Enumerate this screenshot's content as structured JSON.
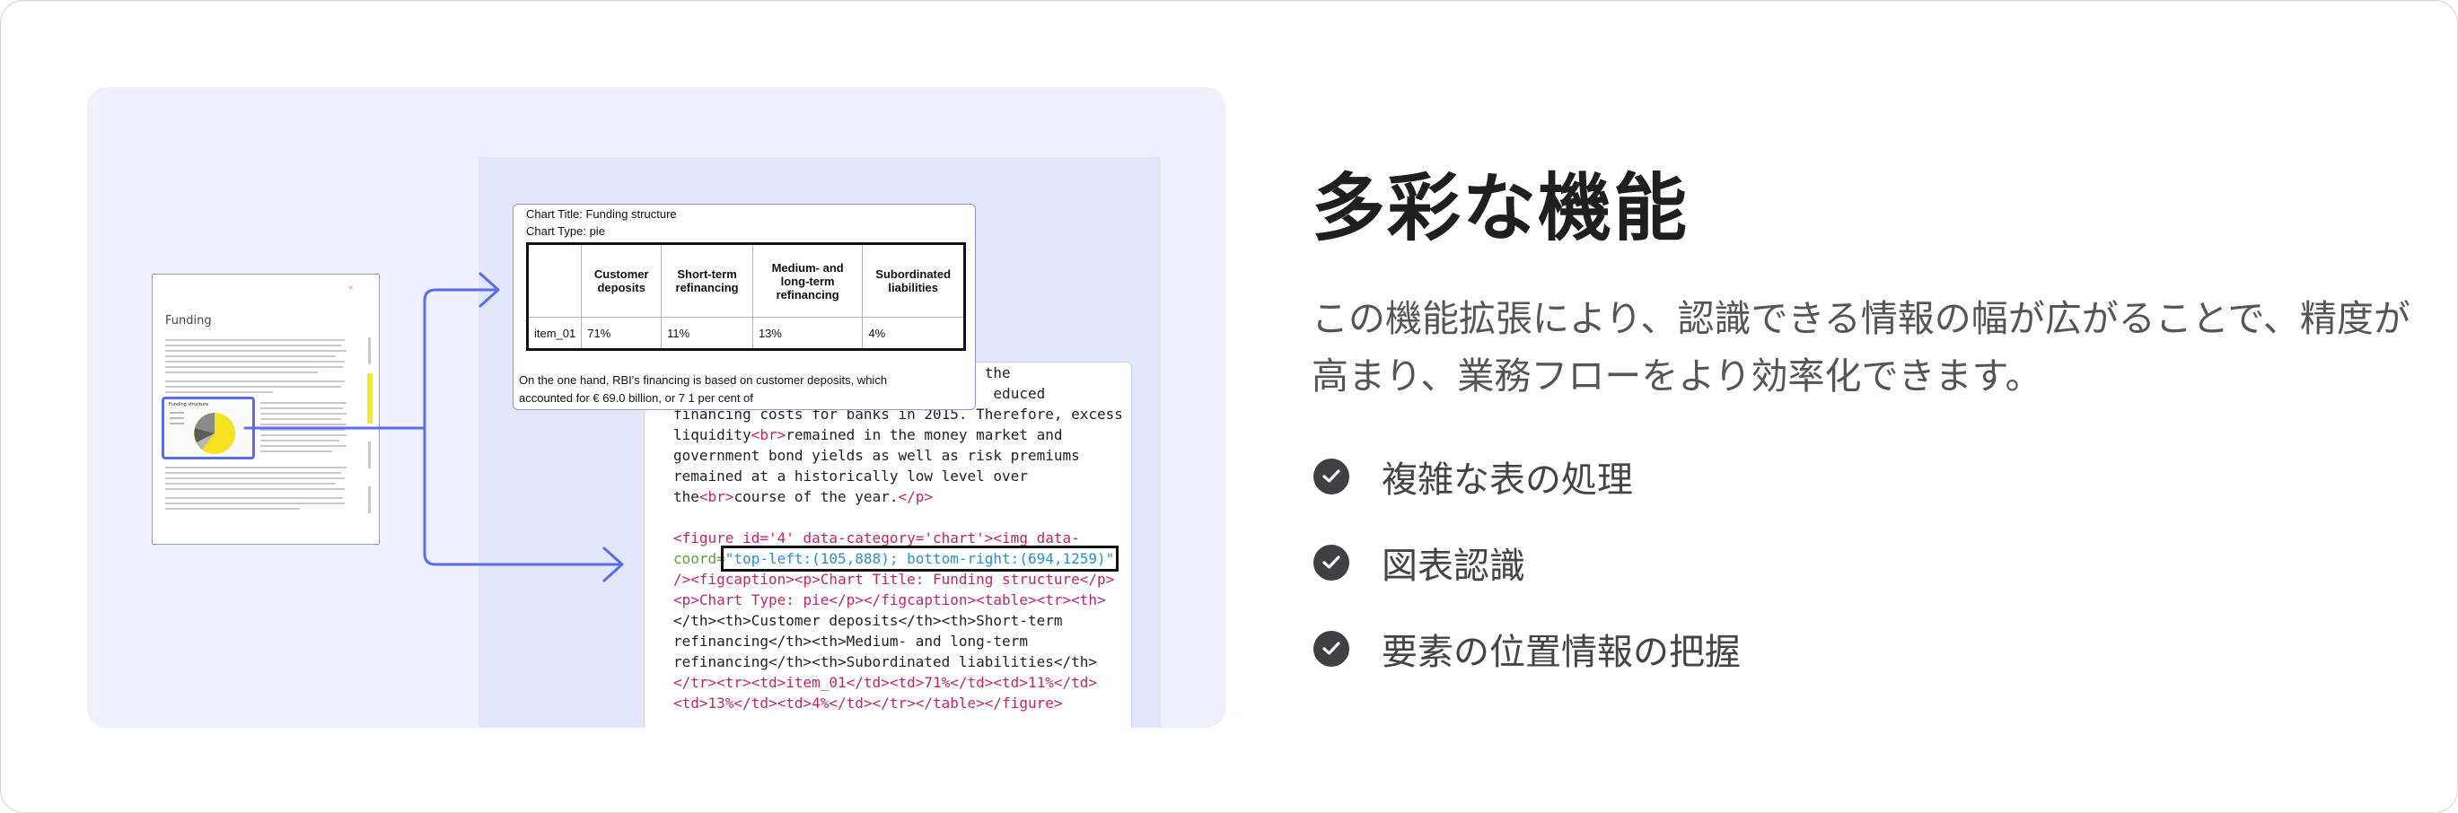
{
  "document_thumbnail": {
    "title": "Funding",
    "close_mark": "×",
    "figure_label": "Funding structure"
  },
  "table_card": {
    "chart_title_line": "Chart Title: Funding structure",
    "chart_type_line": "Chart Type: pie",
    "columns": [
      "",
      "Customer deposits",
      "Short-term refinancing",
      "Medium- and long-term refinancing",
      "Subordinated liabilities"
    ],
    "row": [
      "item_01",
      "71%",
      "11%",
      "13%",
      "4%"
    ],
    "paragraph": "On the one hand, RBI's financing is based on customer deposits, which accounted for € 69.0 billion, or 7 1 per cent of"
  },
  "code_card": {
    "lines_text": [
      "sult, the",
      "educed",
      "financing costs for banks in 2015. Therefore, excess",
      "liquidity",
      "remained in the money market and",
      "government bond yields as well as risk premiums",
      "remained at a historically low level over",
      "the",
      "course of the year.",
      "<figure id='4' data-category='chart'><img data-",
      "coord=\"top-left:(105,888); bottom-right:(694,1259)\"",
      "/><figcaption><p>Chart Title: Funding structure</p>",
      "<p>Chart Type: pie</p></figcaption><table><tr><th>",
      "</th><th>Customer deposits</th><th>Short-term",
      "refinancing</th><th>Medium- and long-term",
      "refinancing</th><th>Subordinated liabilities</th>",
      "</tr><tr><td>item_01</td><td>71%</td><td>11%</td>",
      "<td>13%</td><td>4%</td></tr></table></figure>"
    ]
  },
  "heading": "多彩な機能",
  "description": "この機能拡張により、認識できる情報の幅が広がることで、精度が高まり、業務フローをより効率化できます。",
  "features": [
    {
      "label": "複雑な表の処理",
      "icon": "check-circle-icon"
    },
    {
      "label": "図表認識",
      "icon": "check-circle-icon"
    },
    {
      "label": "要素の位置情報の把握",
      "icon": "check-circle-icon"
    }
  ],
  "colors": {
    "accent": "#5b6cf0",
    "panel_bg": "#eef1fd",
    "check_bg": "#3f3f46",
    "pie_yellow": "#f4e11f"
  }
}
